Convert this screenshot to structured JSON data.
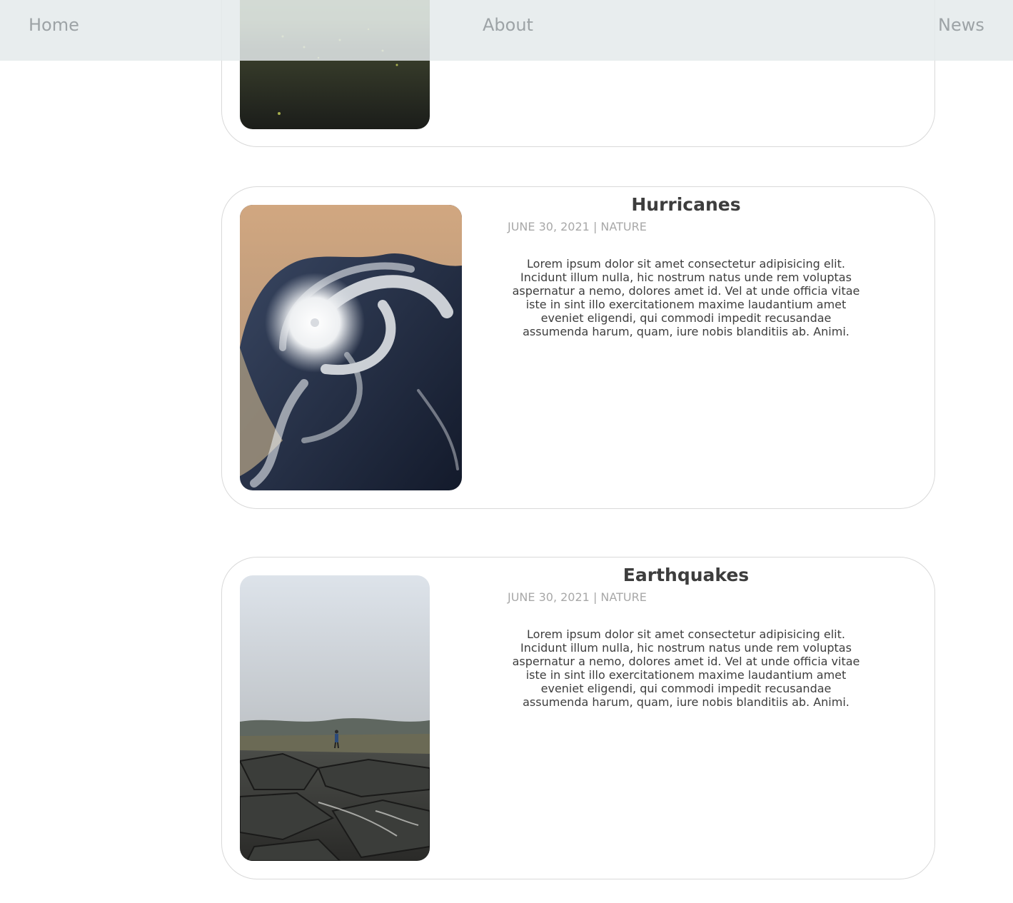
{
  "nav": {
    "home_label": "Home",
    "about_label": "About",
    "news_label": "News"
  },
  "posts": [
    {
      "image": "meadow-field-photo"
    },
    {
      "title": "Hurricanes",
      "date": "JUNE 30, 2021",
      "separator": "|",
      "category": "NATURE",
      "body": "Lorem ipsum dolor sit amet consectetur adipisicing elit. Incidunt illum nulla, hic nostrum natus unde rem voluptas aspernatur a nemo, dolores amet id. Vel at unde officia vitae iste in sint illo exercitationem maxime laudantium amet eveniet eligendi, qui commodi impedit recusandae assumenda harum, quam, iure nobis blanditiis ab. Animi.",
      "image": "hurricane-satellite-photo"
    },
    {
      "title": "Earthquakes",
      "date": "JUNE 30, 2021",
      "separator": "|",
      "category": "NATURE",
      "body": "Lorem ipsum dolor sit amet consectetur adipisicing elit. Incidunt illum nulla, hic nostrum natus unde rem voluptas aspernatur a nemo, dolores amet id. Vel at unde officia vitae iste in sint illo exercitationem maxime laudantium amet eveniet eligendi, qui commodi impedit recusandae assumenda harum, quam, iure nobis blanditiis ab. Animi.",
      "image": "cracked-road-photo"
    }
  ]
}
